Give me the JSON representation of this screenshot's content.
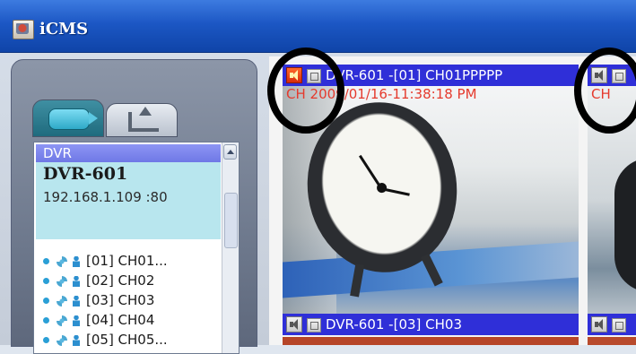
{
  "window": {
    "title": "iCMS"
  },
  "left_panel": {
    "tree_header": "DVR",
    "dvr": {
      "name": "DVR-601",
      "address": "192.168.1.109 :80"
    },
    "channels": [
      {
        "label": "[01] CH01..."
      },
      {
        "label": "[02] CH02"
      },
      {
        "label": "[03] CH03"
      },
      {
        "label": "[04] CH04"
      },
      {
        "label": "[05] CH05..."
      }
    ]
  },
  "tiles": [
    {
      "title": "DVR-601 -[01] CH01PPPPP",
      "osd": "CH  2009/01/16-11:38:18 PM",
      "audio": "on"
    },
    {
      "title": "",
      "osd": "CH",
      "audio": "muted"
    },
    {
      "title": "DVR-601 -[03] CH03",
      "audio": "muted"
    },
    {
      "title": "",
      "audio": "muted"
    }
  ],
  "colors": {
    "titlebar": "#1c57c4",
    "tile_header": "#2f2fd8",
    "osd_text": "#e53a2d",
    "tree_header": "#6f78e6",
    "dvr_selection": "#b8e6ee",
    "highlight_circle": "#000000"
  }
}
